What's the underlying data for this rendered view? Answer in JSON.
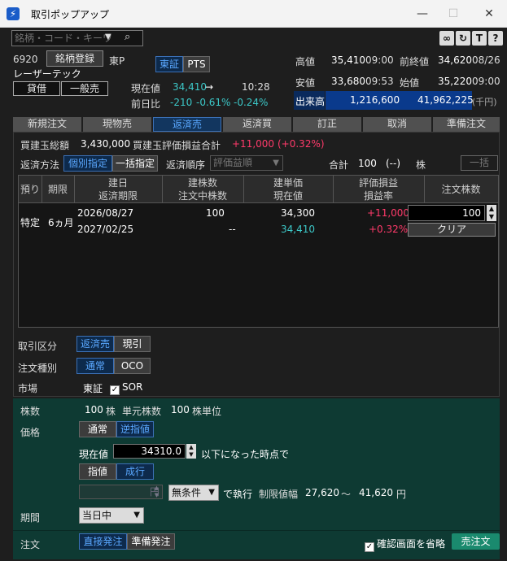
{
  "window": {
    "title": "取引ポップアップ",
    "app_icon": "⚡"
  },
  "search": {
    "placeholder": "銘柄・コード・キーワード"
  },
  "stock": {
    "code": "6920",
    "register_label": "銘柄登録",
    "market": "東P",
    "name": "レーザーテック",
    "tag1": "貸借",
    "tag2": "一般売",
    "exchange1": "東証",
    "exchange2": "PTS"
  },
  "price": {
    "cur_label": "現在値",
    "cur_value": "34,410",
    "cur_arrow": "→",
    "cur_time": "10:28",
    "chg_label": "前日比",
    "chg_value": "-210",
    "chg_pct": "-0.61%",
    "chg_pct2": "-0.24%"
  },
  "quote": {
    "high_label": "高値",
    "high": "35,410",
    "high_time": "09:00",
    "prev_label": "前終値",
    "prev": "34,620",
    "prev_date": "08/26",
    "low_label": "安値",
    "low": "33,680",
    "low_time": "09:53",
    "open_label": "始値",
    "open": "35,220",
    "open_time": "09:00",
    "vol_label": "出来高",
    "vol": "1,216,600",
    "turnover": "41,962,225",
    "unit": "(千円)"
  },
  "tabs": [
    "新規注文",
    "現物売",
    "返済売",
    "返済買",
    "訂正",
    "取消",
    "準備注文"
  ],
  "summary": {
    "total_label": "買建玉総額",
    "total": "3,430,000",
    "pl_label": "買建玉評価損益合計",
    "pl": "+11,000",
    "pl_pct": "(+0.32%)"
  },
  "repay": {
    "method_label": "返済方法",
    "m1": "個別指定",
    "m2": "一括指定",
    "order_label": "返済順序",
    "order_value": "評価益順",
    "sum_label": "合計",
    "sum": "100",
    "sum2": "(--)",
    "sum_unit": "株",
    "bulk": "一括"
  },
  "grid": {
    "headers": {
      "c1": "預り",
      "c2": "期限",
      "c3a": "建日",
      "c3b": "返済期限",
      "c4a": "建株数",
      "c4b": "注文中株数",
      "c5a": "建単価",
      "c5b": "現在値",
      "c6a": "評価損益",
      "c6b": "損益率",
      "c7": "注文株数"
    },
    "row": {
      "acct": "特定",
      "term": "6ヵ月",
      "date": "2026/08/27",
      "due": "2027/02/25",
      "qty": "100",
      "ordering": "--",
      "price": "34,300",
      "current": "34,410",
      "pl": "+11,000",
      "plpct": "+0.32%",
      "order_qty": "100",
      "clear": "クリア"
    }
  },
  "form": {
    "kubun_label": "取引区分",
    "k1": "返済売",
    "k2": "現引",
    "shubetsu_label": "注文種別",
    "s1": "通常",
    "s2": "OCO",
    "market_label": "市場",
    "market_value": "東証",
    "sor": "SOR"
  },
  "order": {
    "qty_label": "株数",
    "qty": "100",
    "qty_unit": "株",
    "unit_label": "単元株数",
    "unit_qty": "100",
    "unit_unit": "株単位",
    "price_label": "価格",
    "p1": "通常",
    "p2": "逆指値",
    "trigger_label": "現在値",
    "trigger": "34310.0",
    "trigger_text": "以下になった時点で",
    "t1": "指値",
    "t2": "成行",
    "yen_placeholder": "円",
    "cond": "無条件",
    "exec": "で執行",
    "limit_label": "制限値幅",
    "limit_low": "27,620",
    "limit_sep": "〜",
    "limit_high": "41,620",
    "limit_unit": "円",
    "period_label": "期間",
    "period": "当日中",
    "order_label": "注文",
    "o1": "直接発注",
    "o2": "準備発注",
    "confirm": "確認画面を省略",
    "submit": "売注文"
  }
}
